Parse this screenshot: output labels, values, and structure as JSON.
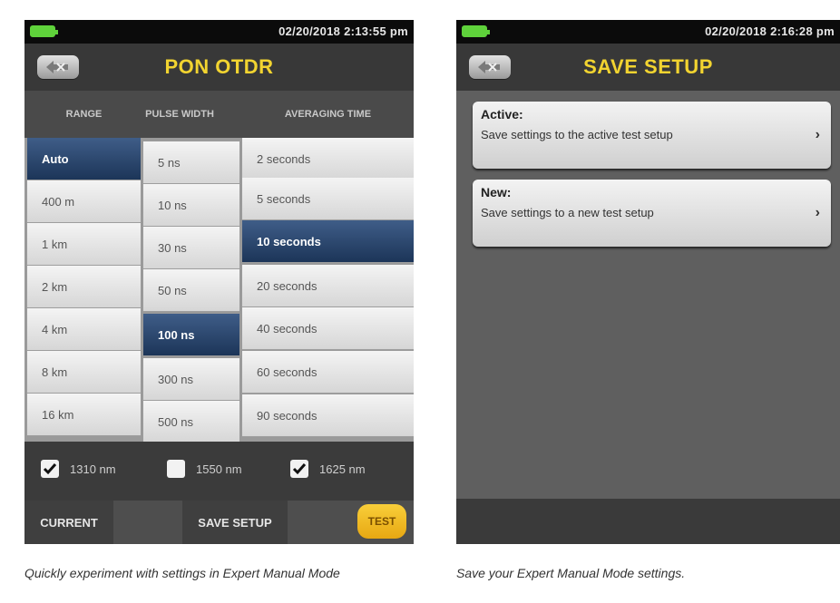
{
  "left": {
    "datetime": "02/20/2018 2:13:55 pm",
    "title": "PON OTDR",
    "headers": {
      "range": "RANGE",
      "pulse": "PULSE WIDTH",
      "avg": "AVERAGING TIME"
    },
    "range": [
      "Auto",
      "400 m",
      "1 km",
      "2 km",
      "4 km",
      "8 km",
      "16 km"
    ],
    "pulse": [
      "5 ns",
      "10 ns",
      "30 ns",
      "50 ns",
      "100 ns",
      "300 ns",
      "500 ns"
    ],
    "avg": [
      "2 seconds",
      "5 seconds",
      "10 seconds",
      "20 seconds",
      "40 seconds",
      "60 seconds",
      "90 seconds"
    ],
    "wavelengths": [
      {
        "label": "1310 nm",
        "checked": true
      },
      {
        "label": "1550 nm",
        "checked": false
      },
      {
        "label": "1625 nm",
        "checked": true
      }
    ],
    "buttons": {
      "current": "CURRENT",
      "save": "SAVE SETUP",
      "test": "TEST"
    },
    "caption": "Quickly experiment with settings in Expert Manual Mode"
  },
  "right": {
    "datetime": "02/20/2018 2:16:28 pm",
    "title": "SAVE SETUP",
    "options": [
      {
        "title": "Active:",
        "desc": "Save settings to the active test setup"
      },
      {
        "title": "New:",
        "desc": "Save settings to a new test setup"
      }
    ],
    "caption": "Save your Expert Manual Mode settings."
  },
  "colors": {
    "title": "#f2d430",
    "selected": "#27436b",
    "battery": "#5fd23b",
    "test": "#f2bd2a"
  }
}
